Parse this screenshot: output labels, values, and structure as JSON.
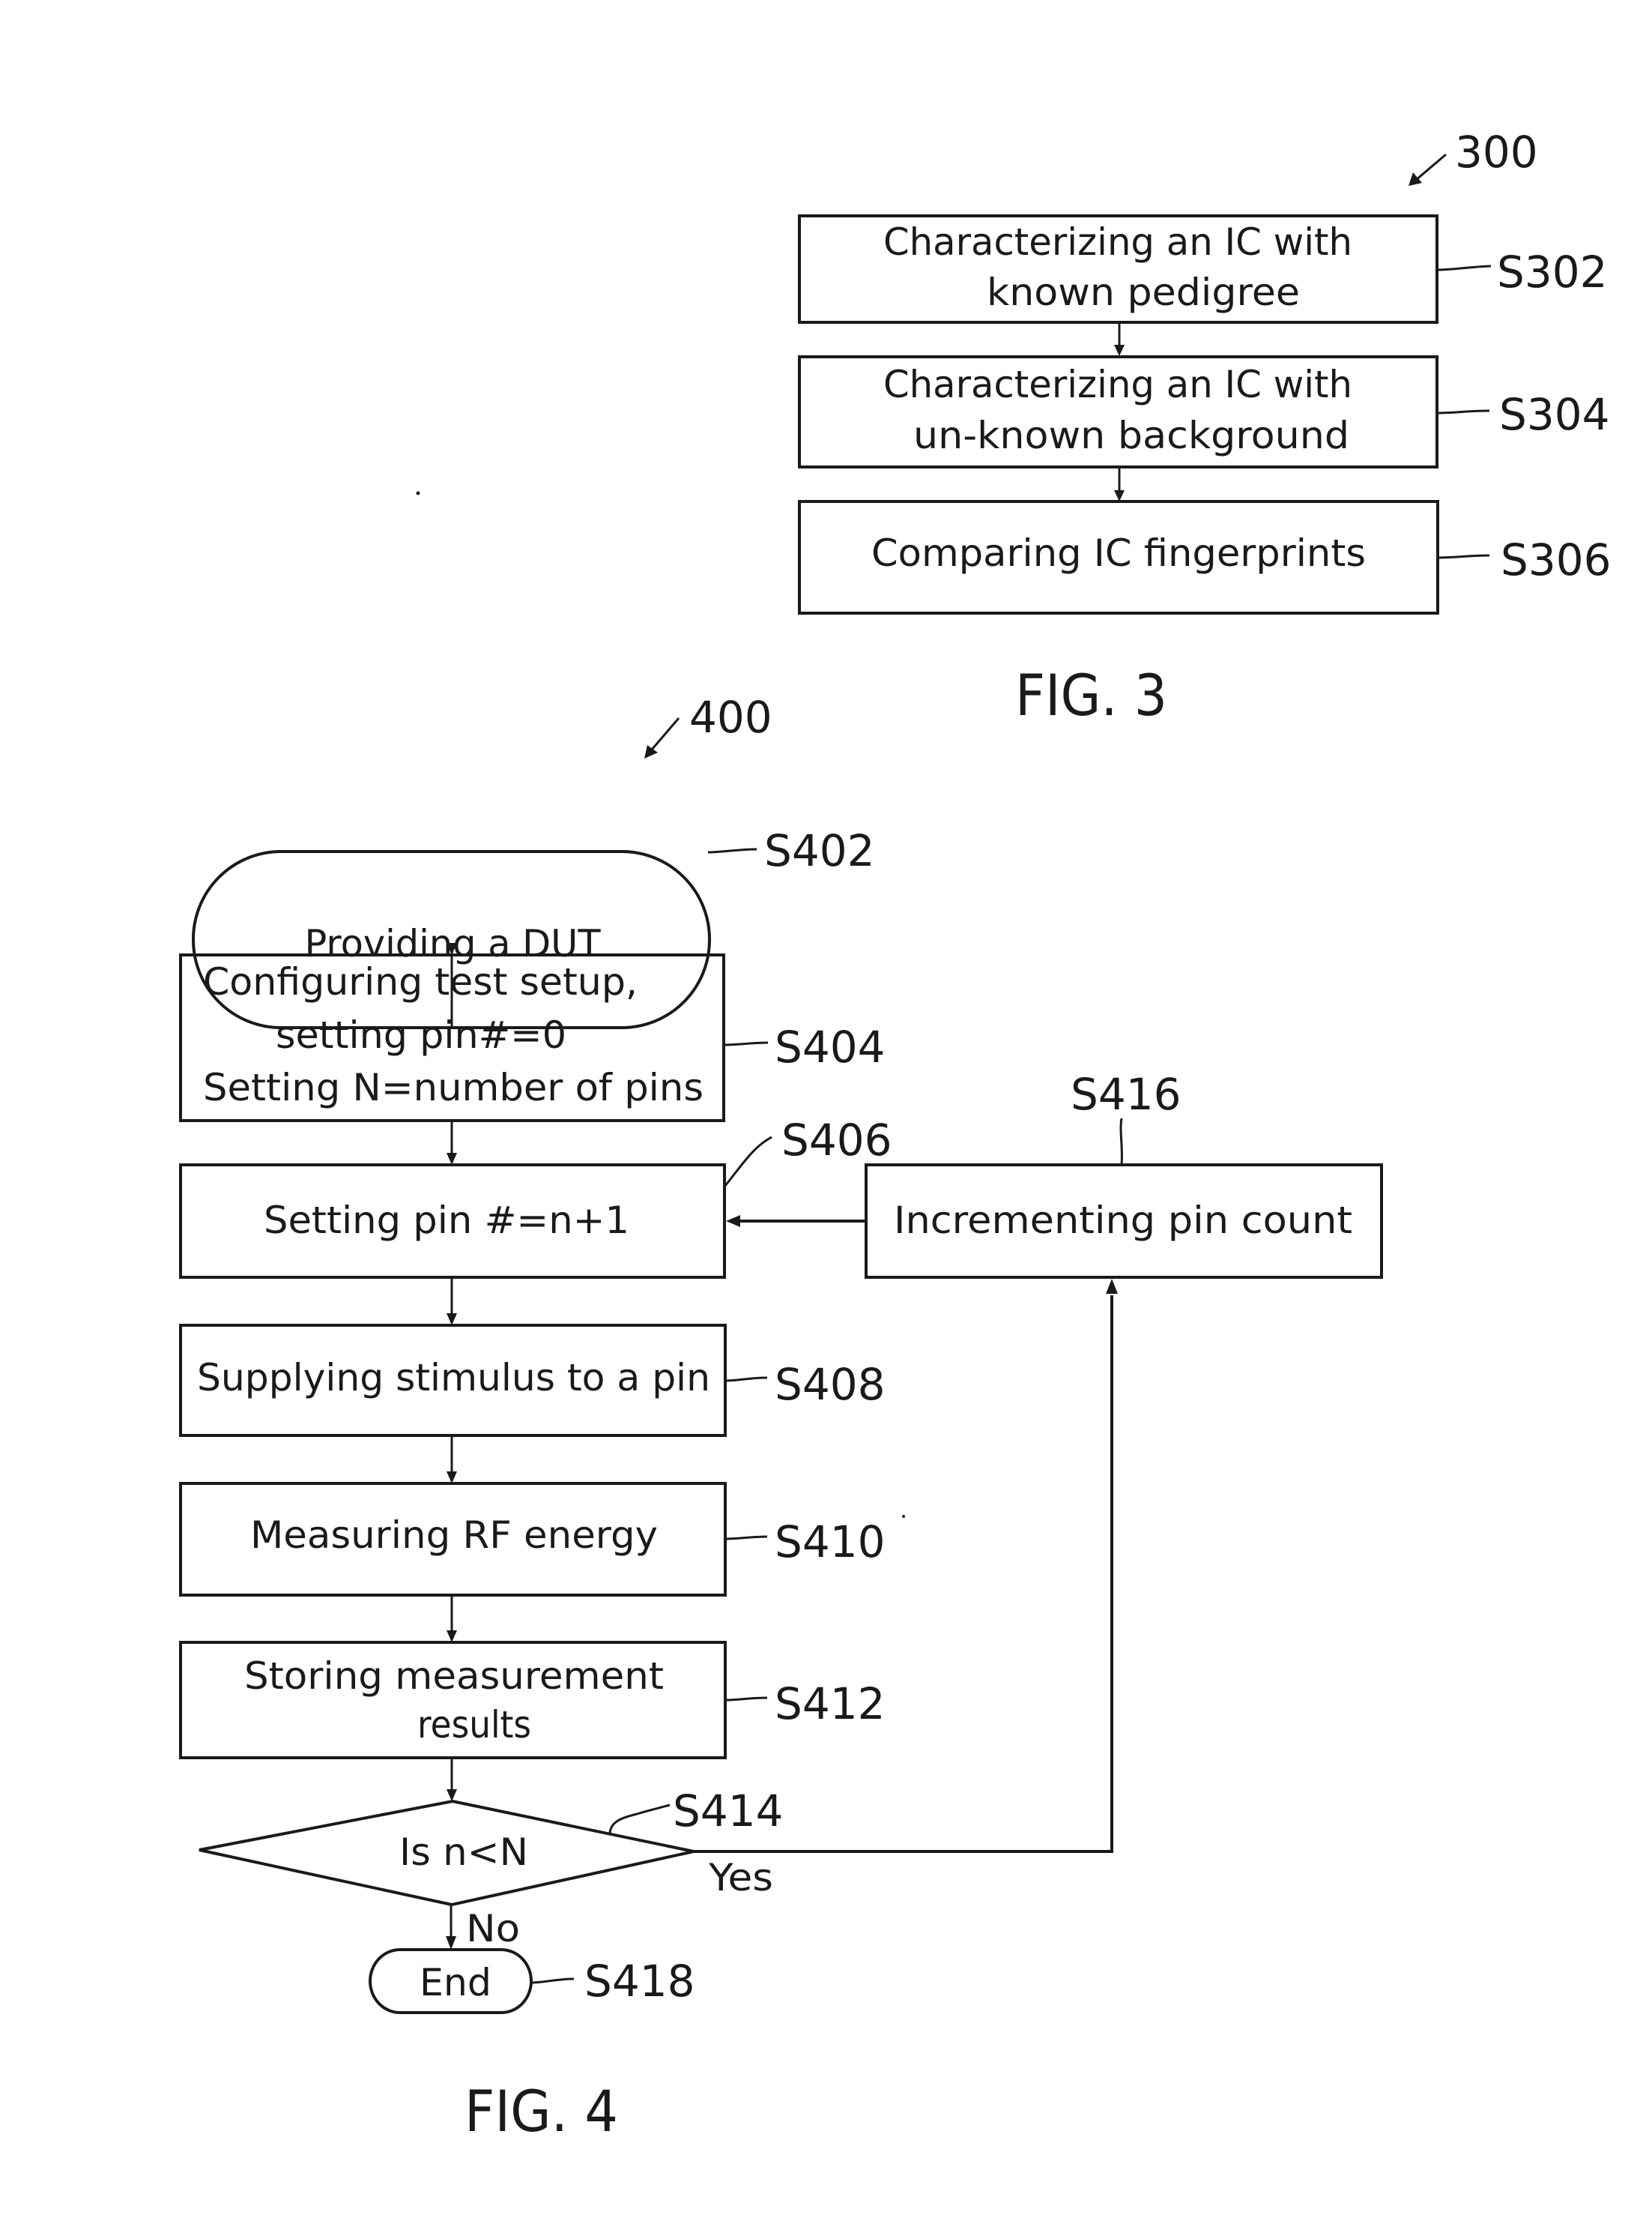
{
  "figures": [
    {
      "caption": "FIG. 3",
      "reference": "300",
      "steps": [
        {
          "id": "S302",
          "lines": [
            "Characterizing an IC with",
            "known pedigree"
          ]
        },
        {
          "id": "S304",
          "lines": [
            "Characterizing an IC with",
            "un-known background"
          ]
        },
        {
          "id": "S306",
          "lines": [
            "Comparing IC fingerprints"
          ]
        }
      ]
    },
    {
      "caption": "FIG. 4",
      "reference": "400",
      "steps": [
        {
          "id": "S402",
          "shape": "terminator",
          "lines": [
            "Providing a DUT"
          ]
        },
        {
          "id": "S404",
          "shape": "process",
          "lines": [
            "Configuring test setup,",
            "setting pin#=0",
            "Setting N=number of pins"
          ]
        },
        {
          "id": "S406",
          "shape": "process",
          "lines": [
            "Setting pin #=n+1"
          ]
        },
        {
          "id": "S408",
          "shape": "process",
          "lines": [
            "Supplying stimulus to a pin"
          ]
        },
        {
          "id": "S410",
          "shape": "process",
          "lines": [
            "Measuring RF energy"
          ]
        },
        {
          "id": "S412",
          "shape": "process",
          "lines": [
            "Storing measurement",
            "results"
          ]
        },
        {
          "id": "S414",
          "shape": "decision",
          "lines": [
            "Is n<N"
          ]
        },
        {
          "id": "S416",
          "shape": "process",
          "lines": [
            "Incrementing pin count"
          ]
        },
        {
          "id": "S418",
          "shape": "terminator",
          "lines": [
            "End"
          ]
        }
      ],
      "branches": {
        "yes_label": "Yes",
        "no_label": "No"
      }
    }
  ]
}
